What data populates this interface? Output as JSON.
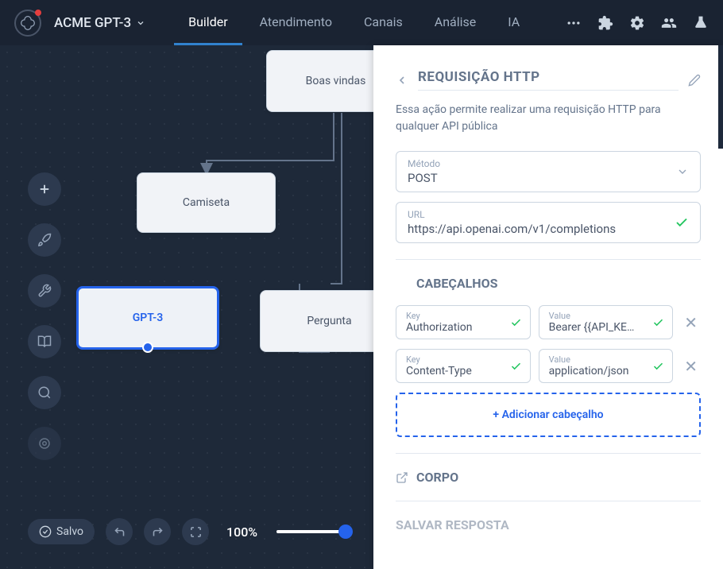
{
  "app": {
    "title": "ACME GPT-3"
  },
  "nav": {
    "tabs": [
      "Builder",
      "Atendimento",
      "Canais",
      "Análise",
      "IA"
    ],
    "active": 0
  },
  "canvas": {
    "nodes": {
      "welcome": "Boas vindas",
      "shirt": "Camiseta",
      "gpt": "GPT-3",
      "question": "Pergunta"
    },
    "save_status": "Salvo",
    "zoom": "100%"
  },
  "panel": {
    "title": "REQUISIÇÃO HTTP",
    "description": "Essa ação permite realizar uma requisição HTTP para qualquer API pública",
    "method": {
      "label": "Método",
      "value": "POST"
    },
    "url": {
      "label": "URL",
      "value": "https://api.openai.com/v1/completions"
    },
    "headers_title": "CABEÇALHOS",
    "headers": [
      {
        "key_label": "Key",
        "key": "Authorization",
        "value_label": "Value",
        "value": "Bearer {{API_KEY}}"
      },
      {
        "key_label": "Key",
        "key": "Content-Type",
        "value_label": "Value",
        "value": "application/json"
      }
    ],
    "add_header": "+ Adicionar cabeçalho",
    "body_title": "CORPO",
    "save_response_title": "SALVAR RESPOSTA"
  }
}
